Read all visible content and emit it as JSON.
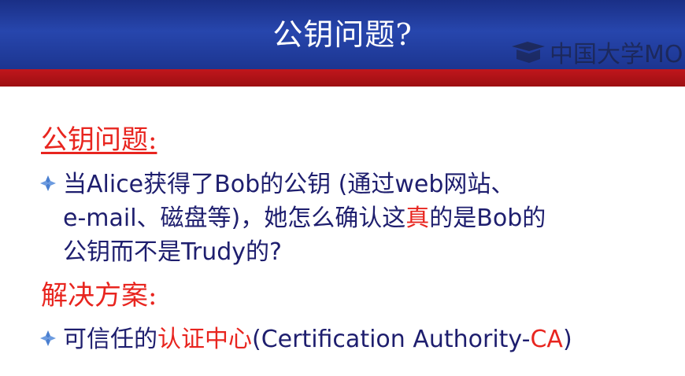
{
  "title": "公钥问题?",
  "watermark": {
    "text": "中国大学MO",
    "icon": "mooc-logo-icon"
  },
  "heading1": "公钥问题:",
  "bullet1": {
    "icon": "diamond-bullet-icon",
    "part_a": "当Alice获得了Bob的公钥 (通过web网站、",
    "part_b": "e-mail、磁盘等)，她怎么确认这",
    "highlight": "真",
    "part_c": "的是Bob的",
    "part_d": "公钥而不是Trudy的?"
  },
  "heading2": "解决方案:",
  "bullet2": {
    "icon": "diamond-bullet-icon",
    "part_a": "可信任的",
    "highlight": "认证中心",
    "part_b": "(Certification Authority-",
    "highlight2": "CA",
    "part_c": ")"
  },
  "colors": {
    "title_bar": "#2746ad",
    "red_band": "#b0121a",
    "accent_red": "#e8251f",
    "body_text": "#1e1e6e",
    "bullet_blue": "#4a7fd0"
  }
}
